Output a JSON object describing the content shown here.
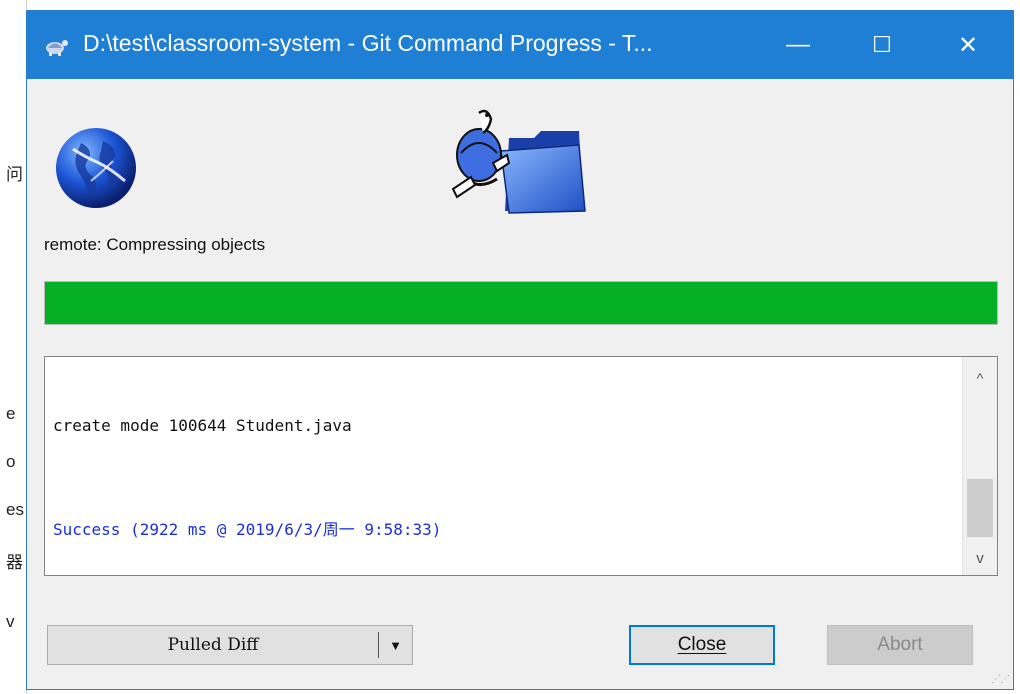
{
  "background_window": {
    "fragments": [
      "问",
      "e",
      "o",
      "es",
      "器",
      "v"
    ]
  },
  "window": {
    "title": "D:\\test\\classroom-system - Git Command Progress - T...",
    "controls": {
      "minimize": "—",
      "maximize": "☐",
      "close": "✕"
    }
  },
  "status_text": "remote: Compressing objects",
  "progress": {
    "fraction": 1.0,
    "color": "#06b025"
  },
  "log": {
    "lines": [
      "create mode 100644 Student.java",
      "Success (2922 ms @ 2019/6/3/周一 9:58:33)"
    ],
    "success_color": "#1c2fd8",
    "scroll_up": "^",
    "scroll_down": "v"
  },
  "buttons": {
    "pulled_diff": "Pulled Diff",
    "dropdown_arrow": "▼",
    "close": "Close",
    "abort": "Abort"
  },
  "icons": {
    "app": "tortoisegit-turtle-icon",
    "remote": "globe-icon",
    "local": "turtle-folder-icon"
  },
  "accent": "#1e7fd5"
}
